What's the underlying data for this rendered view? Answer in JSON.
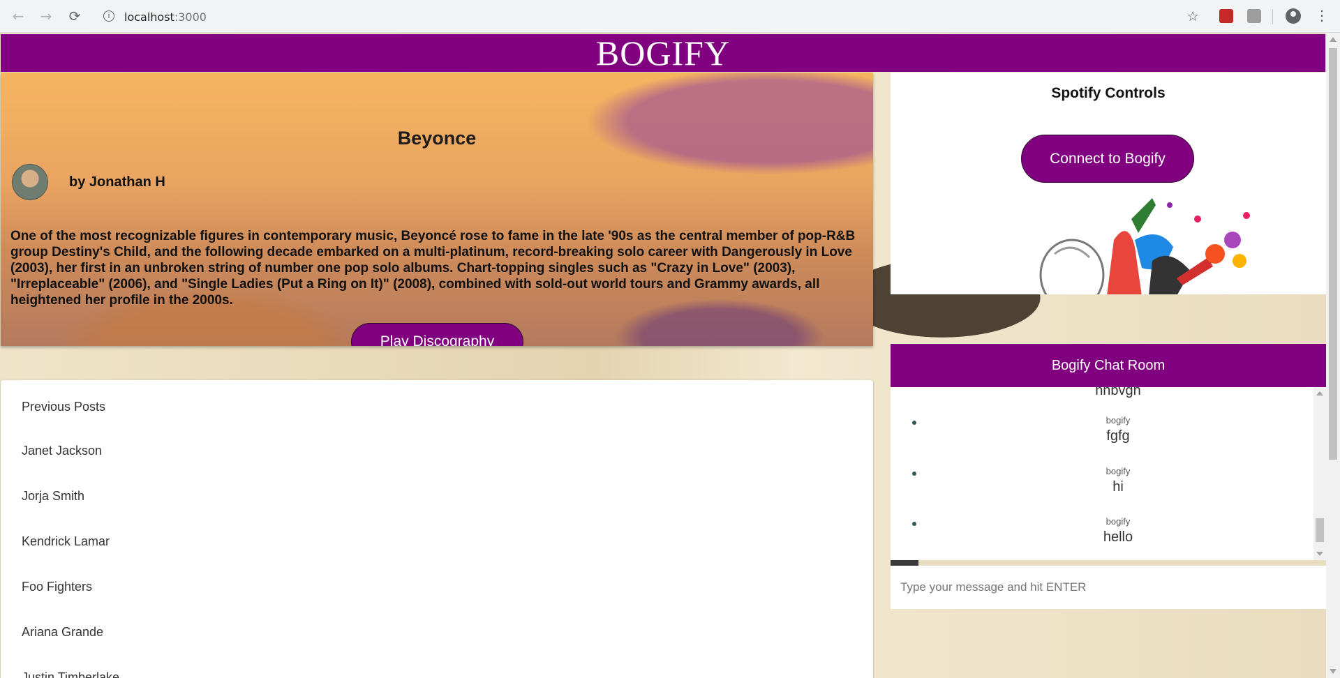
{
  "browser": {
    "url_host": "localhost",
    "url_port": ":3000",
    "back_icon": "←",
    "forward_icon": "→",
    "reload_icon": "⟳",
    "info_icon": "i",
    "star_icon": "☆",
    "menu_icon": "⋮"
  },
  "brand": {
    "title": "BOGIFY",
    "color": "#800080"
  },
  "hero": {
    "title": "Beyonce",
    "author": "by Jonathan H",
    "bio": "One of the most recognizable figures in contemporary music, Beyoncé rose to fame in the late '90s as the central member of pop-R&B group Destiny's Child, and the following decade embarked on a multi-platinum, record-breaking solo career with Dangerously in Love (2003), her first in an unbroken string of number one pop solo albums. Chart-topping singles such as \"Crazy in Love\" (2003), \"Irreplaceable\" (2006), and \"Single Ladies (Put a Ring on It)\" (2008), combined with sold-out world tours and Grammy awards, all heightened her profile in the 2000s.",
    "play_button": "Play Discography"
  },
  "spotify": {
    "title": "Spotify Controls",
    "connect_button": "Connect to Bogify"
  },
  "posts": {
    "heading": "Previous Posts",
    "items": [
      "Janet Jackson",
      "Jorja Smith",
      "Kendrick Lamar",
      "Foo Fighters",
      "Ariana Grande",
      "Justin Timberlake"
    ]
  },
  "chat": {
    "title": "Bogify Chat Room",
    "partial_message": "hhbvgh",
    "messages": [
      {
        "user": "bogify",
        "text": "fgfg"
      },
      {
        "user": "bogify",
        "text": "hi"
      },
      {
        "user": "bogify",
        "text": "hello"
      }
    ],
    "input_placeholder": "Type your message and hit ENTER"
  }
}
